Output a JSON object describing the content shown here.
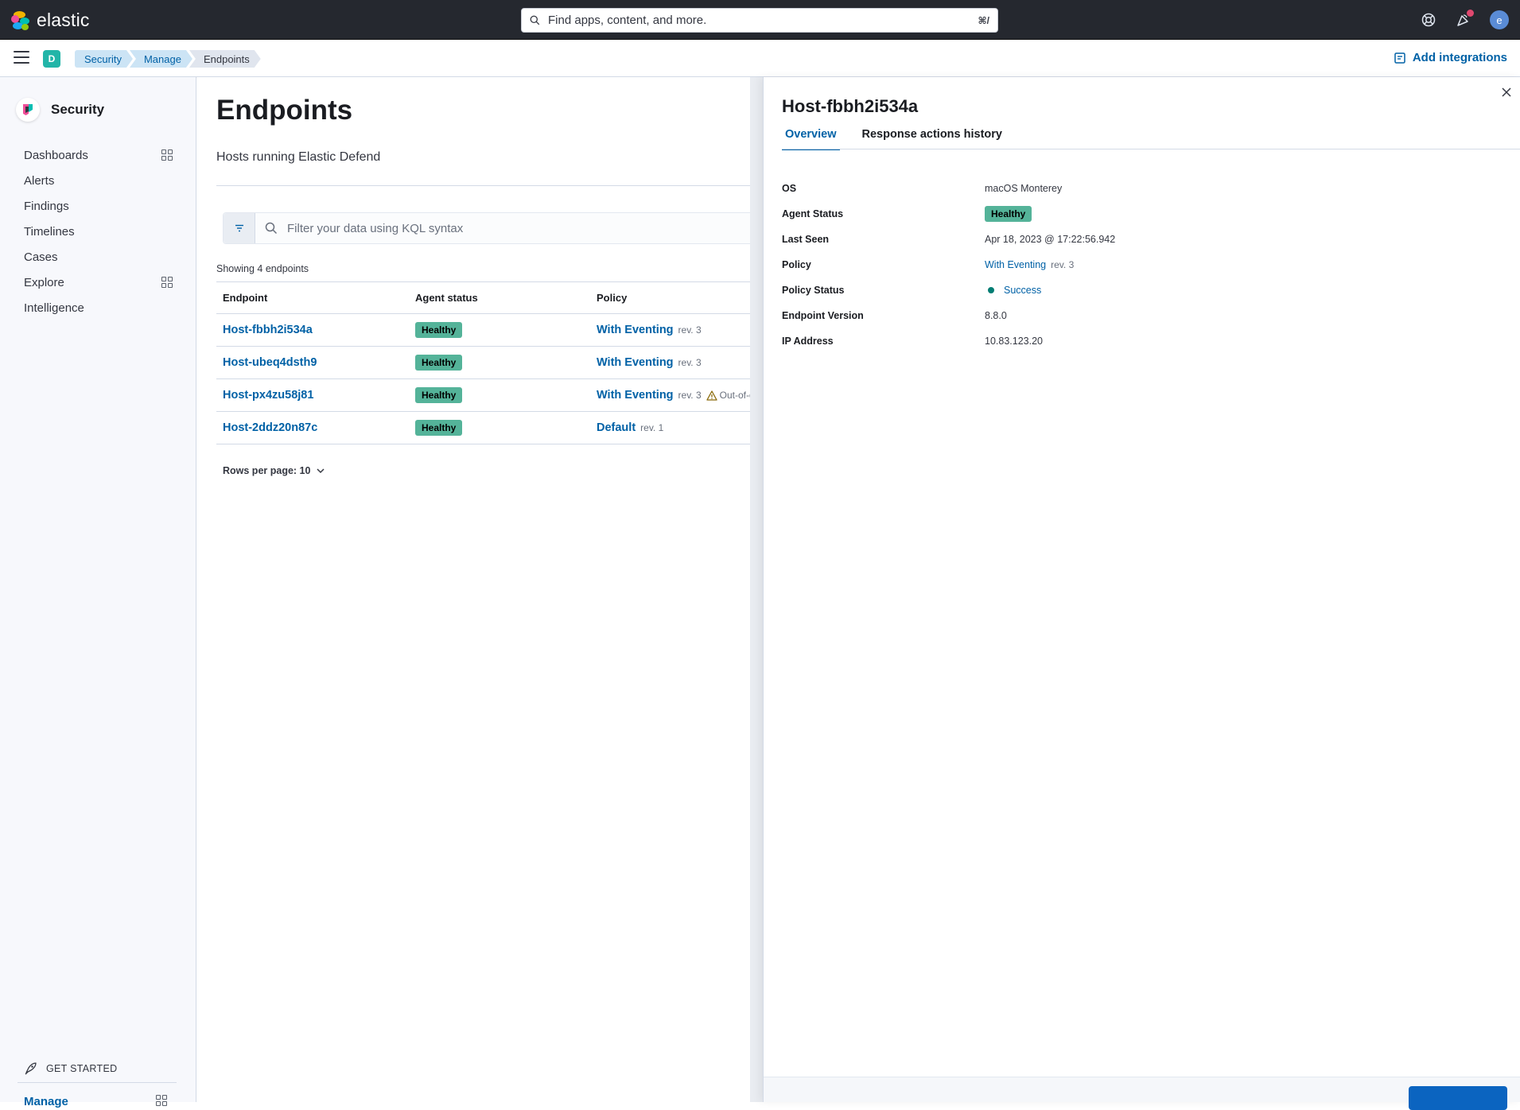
{
  "header": {
    "logo_text": "elastic",
    "search_placeholder": "Find apps, content, and more.",
    "search_shortcut": "⌘/",
    "avatar_initial": "e"
  },
  "subheader": {
    "space_initial": "D",
    "breadcrumbs": [
      "Security",
      "Manage",
      "Endpoints"
    ],
    "add_integrations": "Add integrations"
  },
  "sidenav": {
    "title": "Security",
    "items": [
      {
        "label": "Dashboards",
        "has_grid": true
      },
      {
        "label": "Alerts",
        "has_grid": false
      },
      {
        "label": "Findings",
        "has_grid": false
      },
      {
        "label": "Timelines",
        "has_grid": false
      },
      {
        "label": "Cases",
        "has_grid": false
      },
      {
        "label": "Explore",
        "has_grid": true
      },
      {
        "label": "Intelligence",
        "has_grid": false
      }
    ],
    "get_started": "GET STARTED",
    "manage": "Manage"
  },
  "main": {
    "title": "Endpoints",
    "description": "Hosts running Elastic Defend",
    "query_placeholder": "Filter your data using KQL syntax",
    "showing": "Showing 4 endpoints",
    "columns": [
      "Endpoint",
      "Agent status",
      "Policy"
    ],
    "rows": [
      {
        "endpoint": "Host-fbbh2i534a",
        "status": "Healthy",
        "policy": "With Eventing",
        "rev": "rev. 3",
        "warning": ""
      },
      {
        "endpoint": "Host-ubeq4dsth9",
        "status": "Healthy",
        "policy": "With Eventing",
        "rev": "rev. 3",
        "warning": ""
      },
      {
        "endpoint": "Host-px4zu58j81",
        "status": "Healthy",
        "policy": "With Eventing",
        "rev": "rev. 3",
        "warning": "Out-of-da"
      },
      {
        "endpoint": "Host-2ddz20n87c",
        "status": "Healthy",
        "policy": "Default",
        "rev": "rev. 1",
        "warning": ""
      }
    ],
    "rows_per_page": "Rows per page: 10"
  },
  "flyout": {
    "title": "Host-fbbh2i534a",
    "tabs": [
      "Overview",
      "Response actions history"
    ],
    "details": {
      "os_label": "OS",
      "os_value": "macOS Monterey",
      "agent_status_label": "Agent Status",
      "agent_status_value": "Healthy",
      "last_seen_label": "Last Seen",
      "last_seen_value": "Apr 18, 2023 @ 17:22:56.942",
      "policy_label": "Policy",
      "policy_value": "With Eventing",
      "policy_rev": "rev. 3",
      "policy_status_label": "Policy Status",
      "policy_status_value": "Success",
      "endpoint_version_label": "Endpoint Version",
      "endpoint_version_value": "8.8.0",
      "ip_label": "IP Address",
      "ip_value": "10.83.123.20"
    }
  },
  "colors": {
    "header_bg": "#25282f",
    "link": "#0061a6",
    "healthy_badge": "#54b399",
    "success_dot": "#017d73",
    "space_badge": "#22b5a8"
  }
}
